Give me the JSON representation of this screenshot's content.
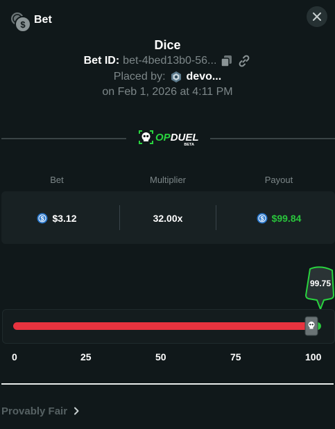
{
  "header": {
    "title": "Bet",
    "close_icon": "close-icon",
    "bet_icon": "coins-icon"
  },
  "bet": {
    "game": "Dice",
    "id_label": "Bet ID:",
    "id_value": "bet-4bed13b0-56...",
    "placed_label": "Placed by:",
    "user": "devo...",
    "date": "on Feb 1, 2026 at 4:11 PM"
  },
  "brand": {
    "name": "OPDUEL",
    "tag": "BETA",
    "accent": "#29d43f"
  },
  "stats": [
    {
      "label": "Bet",
      "value": "$3.12",
      "icon": "coin-icon"
    },
    {
      "label": "Multiplier",
      "value": "32.00x"
    },
    {
      "label": "Payout",
      "value": "$99.84",
      "icon": "coin-icon",
      "color": "#29c53c"
    }
  ],
  "slider": {
    "value": "99.75",
    "ticks": [
      "0",
      "25",
      "50",
      "75",
      "100"
    ],
    "lose_color": "#e8333f",
    "win_color": "#29c53c"
  },
  "footer": {
    "provably_fair": "Provably Fair"
  }
}
